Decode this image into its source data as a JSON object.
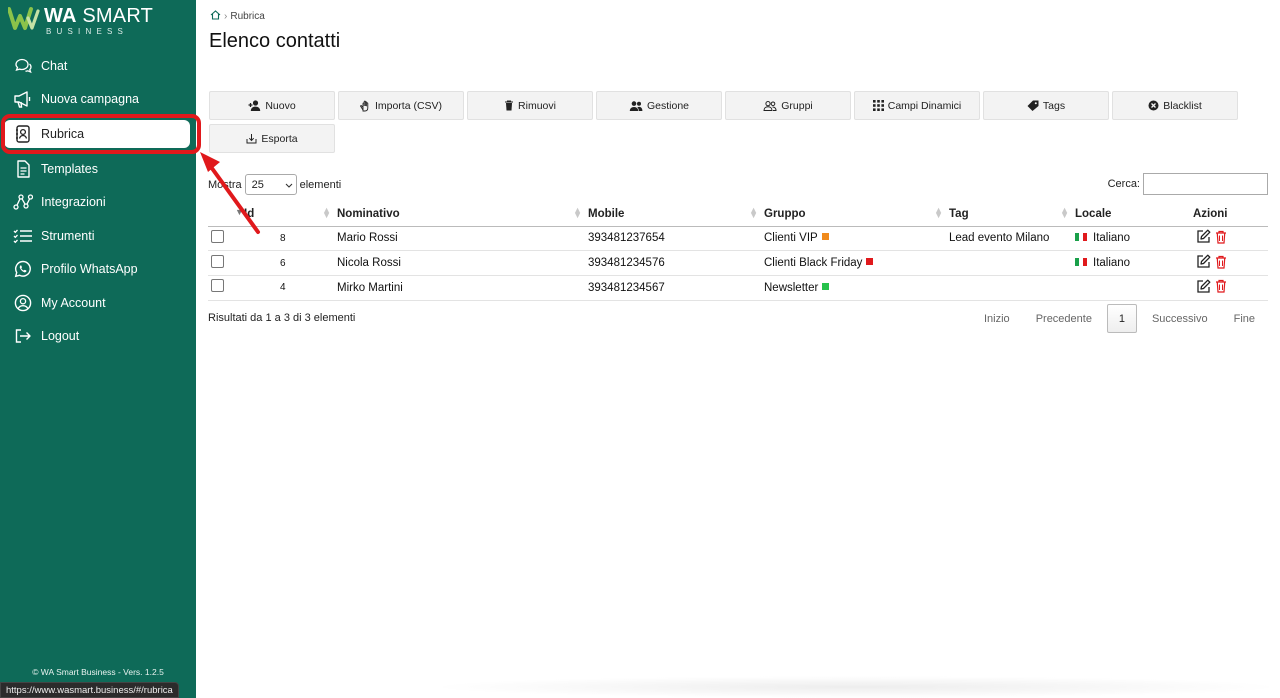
{
  "app": {
    "logo_title_bold": "WA",
    "logo_title_rest": " SMART",
    "logo_subtitle": "BUSINESS",
    "version": "© WA Smart Business - Vers. 1.2.5",
    "status_url": "https://www.wasmart.business/#/rubrica"
  },
  "sidebar": {
    "items": [
      {
        "label": "Chat",
        "icon": "chat-icon"
      },
      {
        "label": "Nuova campagna",
        "icon": "megaphone-icon"
      },
      {
        "label": "Rubrica",
        "icon": "contact-book-icon",
        "active": true
      },
      {
        "label": "Templates",
        "icon": "template-icon"
      },
      {
        "label": "Integrazioni",
        "icon": "integration-icon"
      },
      {
        "label": "Strumenti",
        "icon": "tools-list-icon"
      },
      {
        "label": "Profilo WhatsApp",
        "icon": "whatsapp-icon"
      },
      {
        "label": "My Account",
        "icon": "account-icon"
      },
      {
        "label": "Logout",
        "icon": "logout-icon"
      }
    ]
  },
  "breadcrumb": {
    "home_icon": "home-icon",
    "current": "Rubrica"
  },
  "page": {
    "title": "Elenco contatti"
  },
  "toolbar": {
    "buttons": [
      {
        "label": "Nuovo",
        "icon": "add-user-icon"
      },
      {
        "label": "Importa (CSV)",
        "icon": "import-hand-icon"
      },
      {
        "label": "Rimuovi",
        "icon": "trash-icon"
      },
      {
        "label": "Gestione",
        "icon": "users-icon"
      },
      {
        "label": "Gruppi",
        "icon": "group-icon"
      },
      {
        "label": "Campi Dinamici",
        "icon": "grid-dots-icon"
      },
      {
        "label": "Tags",
        "icon": "tag-icon"
      },
      {
        "label": "Blacklist",
        "icon": "block-icon"
      },
      {
        "label": "Esporta",
        "icon": "export-icon"
      }
    ]
  },
  "table_controls": {
    "show_label": "Mostra",
    "page_length": "25",
    "entries_label": "elementi",
    "search_label": "Cerca:"
  },
  "table": {
    "columns": [
      "Id",
      "Nominativo",
      "Mobile",
      "Gruppo",
      "Tag",
      "Locale",
      "Azioni"
    ],
    "rows": [
      {
        "id": "8",
        "name": "Mario Rossi",
        "mobile": "393481237654",
        "group": "Clienti VIP",
        "group_color": "#f08a1c",
        "tag": "Lead evento Milano",
        "locale": "Italiano"
      },
      {
        "id": "6",
        "name": "Nicola Rossi",
        "mobile": "393481234576",
        "group": "Clienti Black Friday",
        "group_color": "#e0191c",
        "tag": "",
        "locale": "Italiano"
      },
      {
        "id": "4",
        "name": "Mirko Martini",
        "mobile": "393481234567",
        "group": "Newsletter",
        "group_color": "#27c24c",
        "tag": "",
        "locale": ""
      }
    ]
  },
  "footer_table": {
    "info": "Risultati da 1 a 3 di 3 elementi",
    "pager": {
      "first": "Inizio",
      "prev": "Precedente",
      "current": "1",
      "next": "Successivo",
      "last": "Fine"
    }
  },
  "colors": {
    "sidebar_bg": "#0e6a58",
    "highlight": "#e0191c",
    "delete_icon": "#e0191c"
  }
}
